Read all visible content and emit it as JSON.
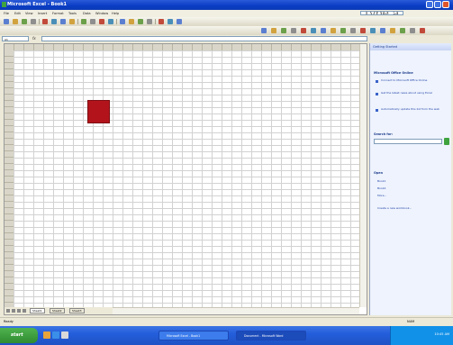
{
  "window": {
    "title": "Microsoft Excel - Book1"
  },
  "menu": {
    "items": [
      "File",
      "Edit",
      "View",
      "Insert",
      "Format",
      "Tools",
      "Data",
      "Window",
      "Help"
    ],
    "help_placeholder": "Type a question for help"
  },
  "toolbar": {
    "row1_icons": [
      "new-icon",
      "open-icon",
      "save-icon",
      "print-icon",
      "preview-icon",
      "spelling-icon",
      "cut-icon",
      "copy-icon",
      "paste-icon",
      "undo-icon",
      "redo-icon",
      "hyperlink-icon",
      "autosum-icon",
      "sort-asc-icon",
      "sort-desc-icon",
      "chart-wizard-icon",
      "drawing-icon",
      "zoom-icon",
      "help-icon"
    ],
    "row2_icons": [
      "bold-icon",
      "italic-icon",
      "underline-icon",
      "align-left-icon",
      "center-icon",
      "align-right-icon",
      "merge-icon",
      "currency-icon",
      "percent-icon",
      "comma-icon",
      "increase-decimal-icon",
      "decrease-decimal-icon",
      "indent-icon",
      "outdent-icon",
      "borders-icon",
      "fill-color-icon",
      "font-color-icon"
    ]
  },
  "formula_bar": {
    "name_box": "A1",
    "fx": "fx",
    "value": ""
  },
  "sheet": {
    "tabs": [
      "Sheet1",
      "Sheet2",
      "Sheet3"
    ],
    "active_tab": 0,
    "shape": {
      "type": "rectangle",
      "fill": "#b3141b"
    }
  },
  "task_pane": {
    "title": "Getting Started",
    "sections": [
      {
        "heading": "Microsoft Office Online",
        "links": [
          "Connect to Microsoft Office Online",
          "Get the latest news about using Excel",
          "Automatically update this list from the web"
        ]
      },
      {
        "heading": "Search for:",
        "links": []
      },
      {
        "heading": "Open",
        "links": [
          "Book1",
          "Book2",
          "More...",
          "Create a new workbook..."
        ]
      }
    ],
    "search_placeholder": ""
  },
  "status": {
    "text": "Ready",
    "mode": "NUM"
  },
  "taskbar": {
    "start": "start",
    "apps": [
      "Microsoft Excel - Book1",
      "Document - Microsoft Word"
    ],
    "clock": "10:45 AM"
  },
  "colors": {
    "titlebar": "#0a3cc4",
    "shape": "#b3141b",
    "taskbar": "#245edb",
    "start": "#3c9a3c"
  }
}
